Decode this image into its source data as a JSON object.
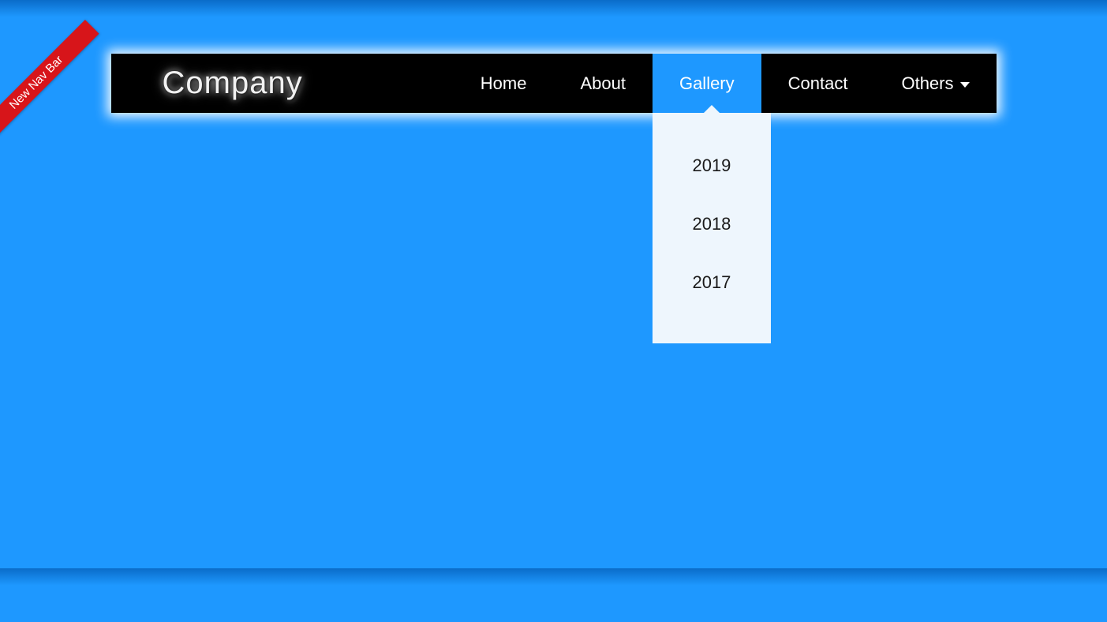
{
  "ribbon": {
    "label": "New Nav Bar"
  },
  "logo": {
    "text": "Company"
  },
  "nav": {
    "items": [
      {
        "label": "Home"
      },
      {
        "label": "About"
      },
      {
        "label": "Gallery",
        "active": true,
        "dropdown": [
          {
            "label": "2019"
          },
          {
            "label": "2018"
          },
          {
            "label": "2017"
          }
        ]
      },
      {
        "label": "Contact"
      },
      {
        "label": "Others",
        "has_caret": true
      }
    ]
  },
  "colors": {
    "background": "#1e98ff",
    "navbar_bg": "#000000",
    "ribbon_bg": "#d7151a",
    "dropdown_bg": "#eef6fd"
  }
}
